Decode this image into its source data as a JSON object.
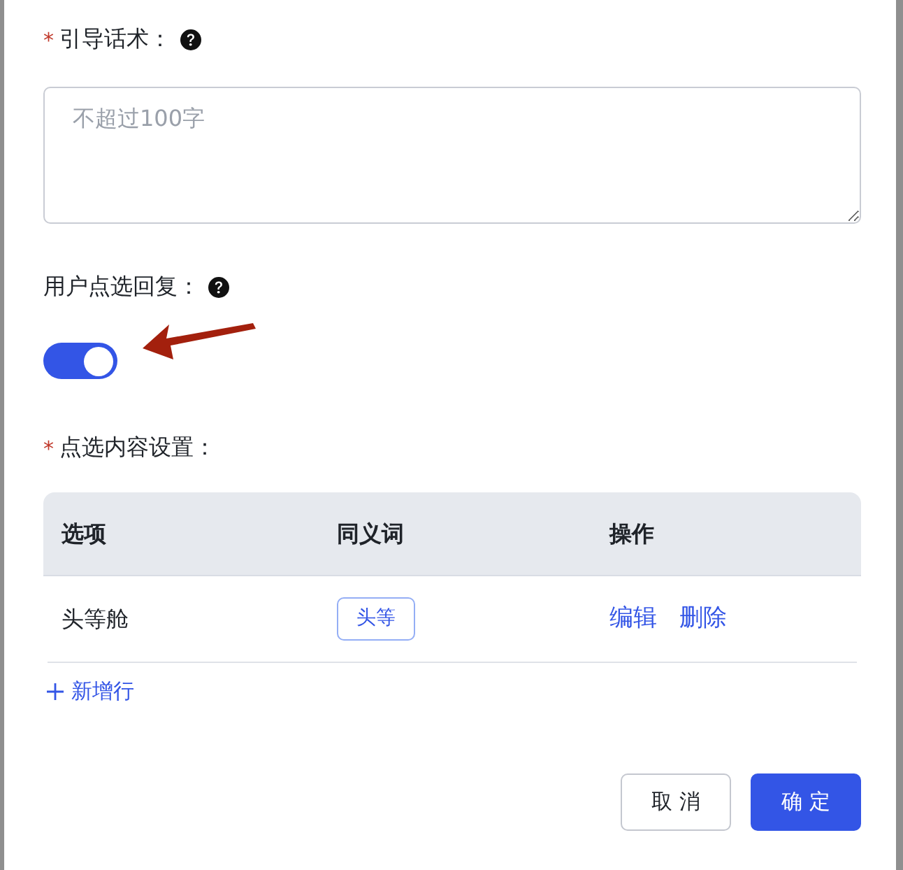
{
  "form_items": [
    {
      "kind": "textarea",
      "required_mark": "*",
      "label": "引导话术：",
      "help": true,
      "placeholder": "不超过100字"
    },
    {
      "kind": "switch",
      "label": "用户点选回复：",
      "help": true,
      "on": true
    },
    {
      "kind": "table",
      "required_mark": "*",
      "label": "点选内容设置：",
      "columns": [
        "选项",
        "同义词",
        "操作"
      ],
      "rows": [
        {
          "option": "头等舱",
          "synonyms": [
            "头等"
          ],
          "actions": [
            "编辑",
            "删除"
          ]
        }
      ],
      "add_row": "新增行"
    }
  ],
  "buttons": [
    {
      "label": "取 消",
      "kind": "default"
    },
    {
      "label": "确 定",
      "kind": "primary"
    }
  ]
}
